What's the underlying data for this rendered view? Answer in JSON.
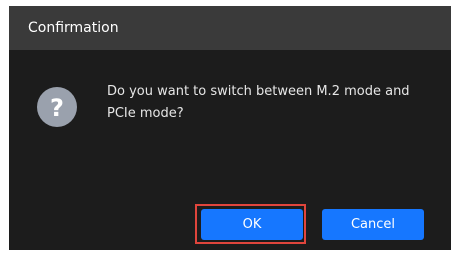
{
  "dialog": {
    "title": "Confirmation",
    "icon": "question-icon",
    "message": "Do you want to switch between M.2 mode and PCIe mode?",
    "ok_label": "OK",
    "cancel_label": "Cancel",
    "question_glyph": "?"
  },
  "colors": {
    "title_bar": "#3a3a3a",
    "body": "#1c1c1c",
    "button": "#1677ff",
    "highlight": "#e0453c",
    "icon": "#9aa1ad"
  }
}
